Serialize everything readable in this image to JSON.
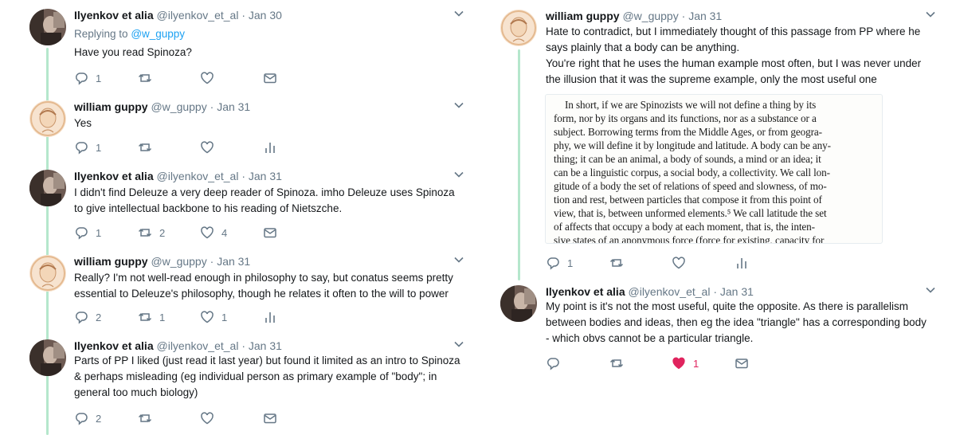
{
  "colors": {
    "name": "#14171a",
    "meta": "#657786",
    "link": "#1da1f2",
    "thread_line": "#b5e7cc",
    "like_active": "#e0245e",
    "highlight": "#f7dcc2"
  },
  "left_thread": [
    {
      "author": "Ilyenkov et alia",
      "handle": "@ilyenkov_et_al",
      "sep": "·",
      "date": "Jan 30",
      "avatar_icon": "avatar-ilyenkov",
      "replying_prefix": "Replying to",
      "replying_handle": "@w_guppy",
      "lines": [
        "Have you read Spinoza?"
      ],
      "actions": {
        "reply": "1",
        "retweet": "",
        "like": "",
        "last_icon": "dm-icon"
      }
    },
    {
      "author": "william guppy",
      "handle": "@w_guppy",
      "sep": "·",
      "date": "Jan 31",
      "avatar_icon": "avatar-guppy",
      "lines": [
        "Yes"
      ],
      "actions": {
        "reply": "1",
        "retweet": "",
        "like": "",
        "last_icon": "analytics-icon"
      }
    },
    {
      "author": "Ilyenkov et alia",
      "handle": "@ilyenkov_et_al",
      "sep": "·",
      "date": "Jan 31",
      "avatar_icon": "avatar-ilyenkov",
      "lines": [
        "I didn't find Deleuze a very deep reader of Spinoza. imho Deleuze uses Spinoza",
        "to give intellectual backbone to his reading of Nietszche."
      ],
      "actions": {
        "reply": "1",
        "retweet": "2",
        "like": "4",
        "last_icon": "dm-icon"
      }
    },
    {
      "author": "william guppy",
      "handle": "@w_guppy",
      "sep": "·",
      "date": "Jan 31",
      "avatar_icon": "avatar-guppy",
      "lines": [
        "Really? I'm not well-read enough in philosophy to say, but conatus seems pretty",
        "essential to Deleuze's philosophy, though he relates it often to the will to power"
      ],
      "actions": {
        "reply": "2",
        "retweet": "1",
        "like": "1",
        "last_icon": "analytics-icon"
      }
    },
    {
      "author": "Ilyenkov et alia",
      "handle": "@ilyenkov_et_al",
      "sep": "·",
      "date": "Jan 31",
      "avatar_icon": "avatar-ilyenkov",
      "lines": [
        "Parts of PP I liked (just read it last year) but found it limited as an intro to Spinoza",
        "& perhaps misleading (eg individual person as primary example of \"body\"; in",
        "general too much biology)"
      ],
      "actions": {
        "reply": "2",
        "retweet": "",
        "like": "",
        "last_icon": "dm-icon"
      }
    }
  ],
  "right_thread": [
    {
      "author": "william guppy",
      "handle": "@w_guppy",
      "sep": "·",
      "date": "Jan 31",
      "avatar_icon": "avatar-guppy",
      "lines": [
        "Hate to contradict, but I immediately thought of this passage from PP where he",
        "says plainly that a body can be anything.",
        "You're right that he uses the human example most often, but I was never under",
        "the illusion that it was the supreme example, only the most useful one"
      ],
      "quote_lines": [
        "In short, if we are Spinozists we will not define a thing by its",
        "form, nor by its organs and its functions, nor as a substance or a",
        "subject. Borrowing terms from the Middle Ages, or from geogra-",
        "phy, we will define it by longitude and latitude. A body can be any-",
        "thing; it can be an animal, a body of sounds, a mind or an idea; it",
        "can be a linguistic corpus, a social body, a collectivity. We call lon-",
        "gitude of a body the set of relations of speed and slowness, of mo-",
        "tion and rest, between particles that compose it from this point of",
        "view, that is, between unformed elements.⁵ We call latitude the set",
        "of affects that occupy a body at each moment, that is, the inten-",
        "sive states of an anonymous force (force for existing, capacity for"
      ],
      "actions": {
        "reply": "1",
        "retweet": "",
        "like": "",
        "last_icon": "analytics-icon"
      }
    },
    {
      "author": "Ilyenkov et alia",
      "handle": "@ilyenkov_et_al",
      "sep": "·",
      "date": "Jan 31",
      "avatar_icon": "avatar-ilyenkov",
      "lines": [
        "My point is it's not the most useful, quite the opposite. As there is parallelism",
        "between bodies and ideas, then eg the idea \"triangle\" has a corresponding body",
        "- which obvs cannot be a particular triangle."
      ],
      "actions": {
        "reply": "",
        "retweet": "",
        "like": "1",
        "like_active": true,
        "last_icon": "dm-icon"
      }
    }
  ]
}
